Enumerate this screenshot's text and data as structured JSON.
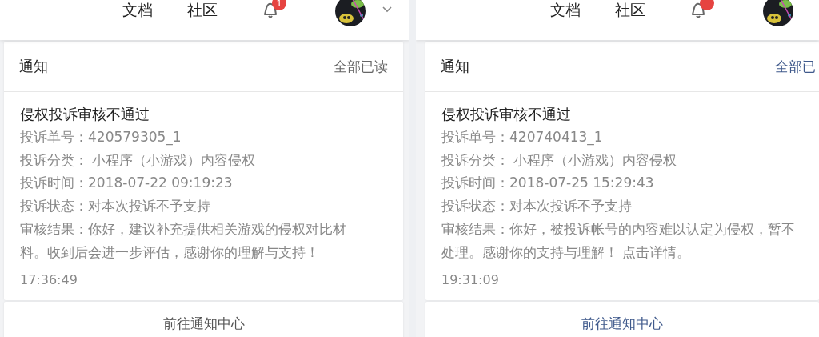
{
  "panels": [
    {
      "nav": [
        "文档",
        "社区"
      ],
      "badge": {
        "kind": "count",
        "count": "1"
      },
      "notice": {
        "title": "通知",
        "mark_all": "全部已读",
        "item": {
          "title": "侵权投诉审核不通过",
          "fields": [
            {
              "label": "投诉单号：",
              "value": "420579305_1"
            },
            {
              "label": "投诉分类：",
              "value": " 小程序（小游戏）内容侵权"
            },
            {
              "label": "投诉时间：",
              "value": "2018-07-22 09:19:23"
            },
            {
              "label": "投诉状态：",
              "value": "对本次投诉不予支持"
            },
            {
              "label": "审核结果：",
              "value": "你好，建议补充提供相关游戏的侵权对比材料。收到后会进一步评估，感谢你的理解与支持！"
            }
          ],
          "time": "17:36:49"
        },
        "footer": "前往通知中心"
      }
    },
    {
      "nav": [
        "文档",
        "社区"
      ],
      "badge": {
        "kind": "dot"
      },
      "notice": {
        "title": "通知",
        "mark_all": "全部已",
        "item": {
          "title": "侵权投诉审核不通过",
          "fields": [
            {
              "label": "投诉单号：",
              "value": "420740413_1"
            },
            {
              "label": "投诉分类：",
              "value": " 小程序（小游戏）内容侵权"
            },
            {
              "label": "投诉时间：",
              "value": "2018-07-25 15:29:43"
            },
            {
              "label": "投诉状态：",
              "value": "对本次投诉不予支持"
            },
            {
              "label": "审核结果：",
              "value": "你好，被投诉帐号的内容难以认定为侵权，暂不处理。感谢你的支持与理解！ 点击详情。"
            }
          ],
          "time": "19:31:09"
        },
        "footer": "前往通知中心"
      }
    }
  ]
}
